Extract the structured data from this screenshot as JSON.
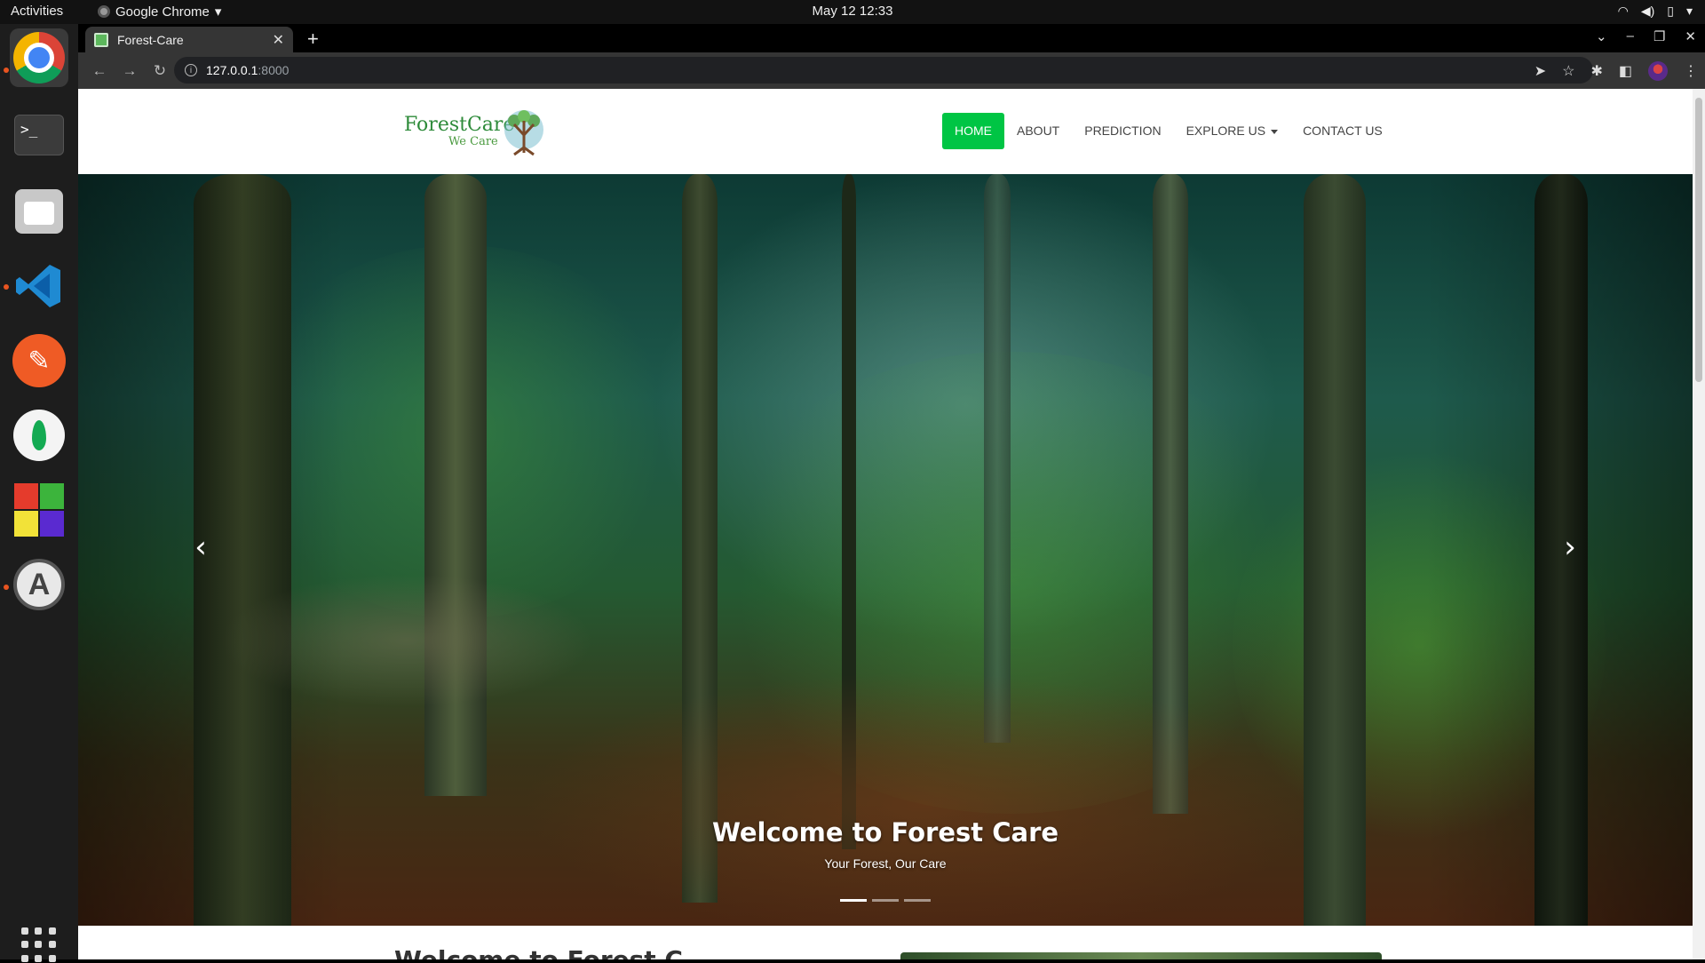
{
  "system": {
    "activities": "Activities",
    "app_menu": "Google Chrome",
    "clock": "May 12  12:33"
  },
  "dock": {
    "apps": [
      "chrome-icon",
      "terminal-icon",
      "files-icon",
      "vscode-icon",
      "postman-icon",
      "mongodb-compass-icon",
      "app-tiles-icon",
      "software-updater-icon"
    ],
    "terminal_glyph": ">_"
  },
  "browser": {
    "tab_title": "Forest-Care",
    "new_tab_glyph": "+",
    "url_host": "127.0.0.1",
    "url_port": ":8000"
  },
  "site": {
    "logo": {
      "brand": "ForestCare",
      "tagline": "We Care"
    },
    "nav": {
      "home": "HOME",
      "about": "ABOUT",
      "prediction": "PREDICTION",
      "explore": "EXPLORE US",
      "contact": "CONTACT US"
    },
    "hero": {
      "title": "Welcome to Forest Care",
      "subtitle": "Your Forest, Our Care",
      "prev": "‹",
      "next": "›",
      "slides": 3,
      "active_slide": 1
    },
    "below_heading": "Welcome to Forest C"
  },
  "colors": {
    "nav_active": "#00c544",
    "brand_green": "#2e8b3a"
  }
}
